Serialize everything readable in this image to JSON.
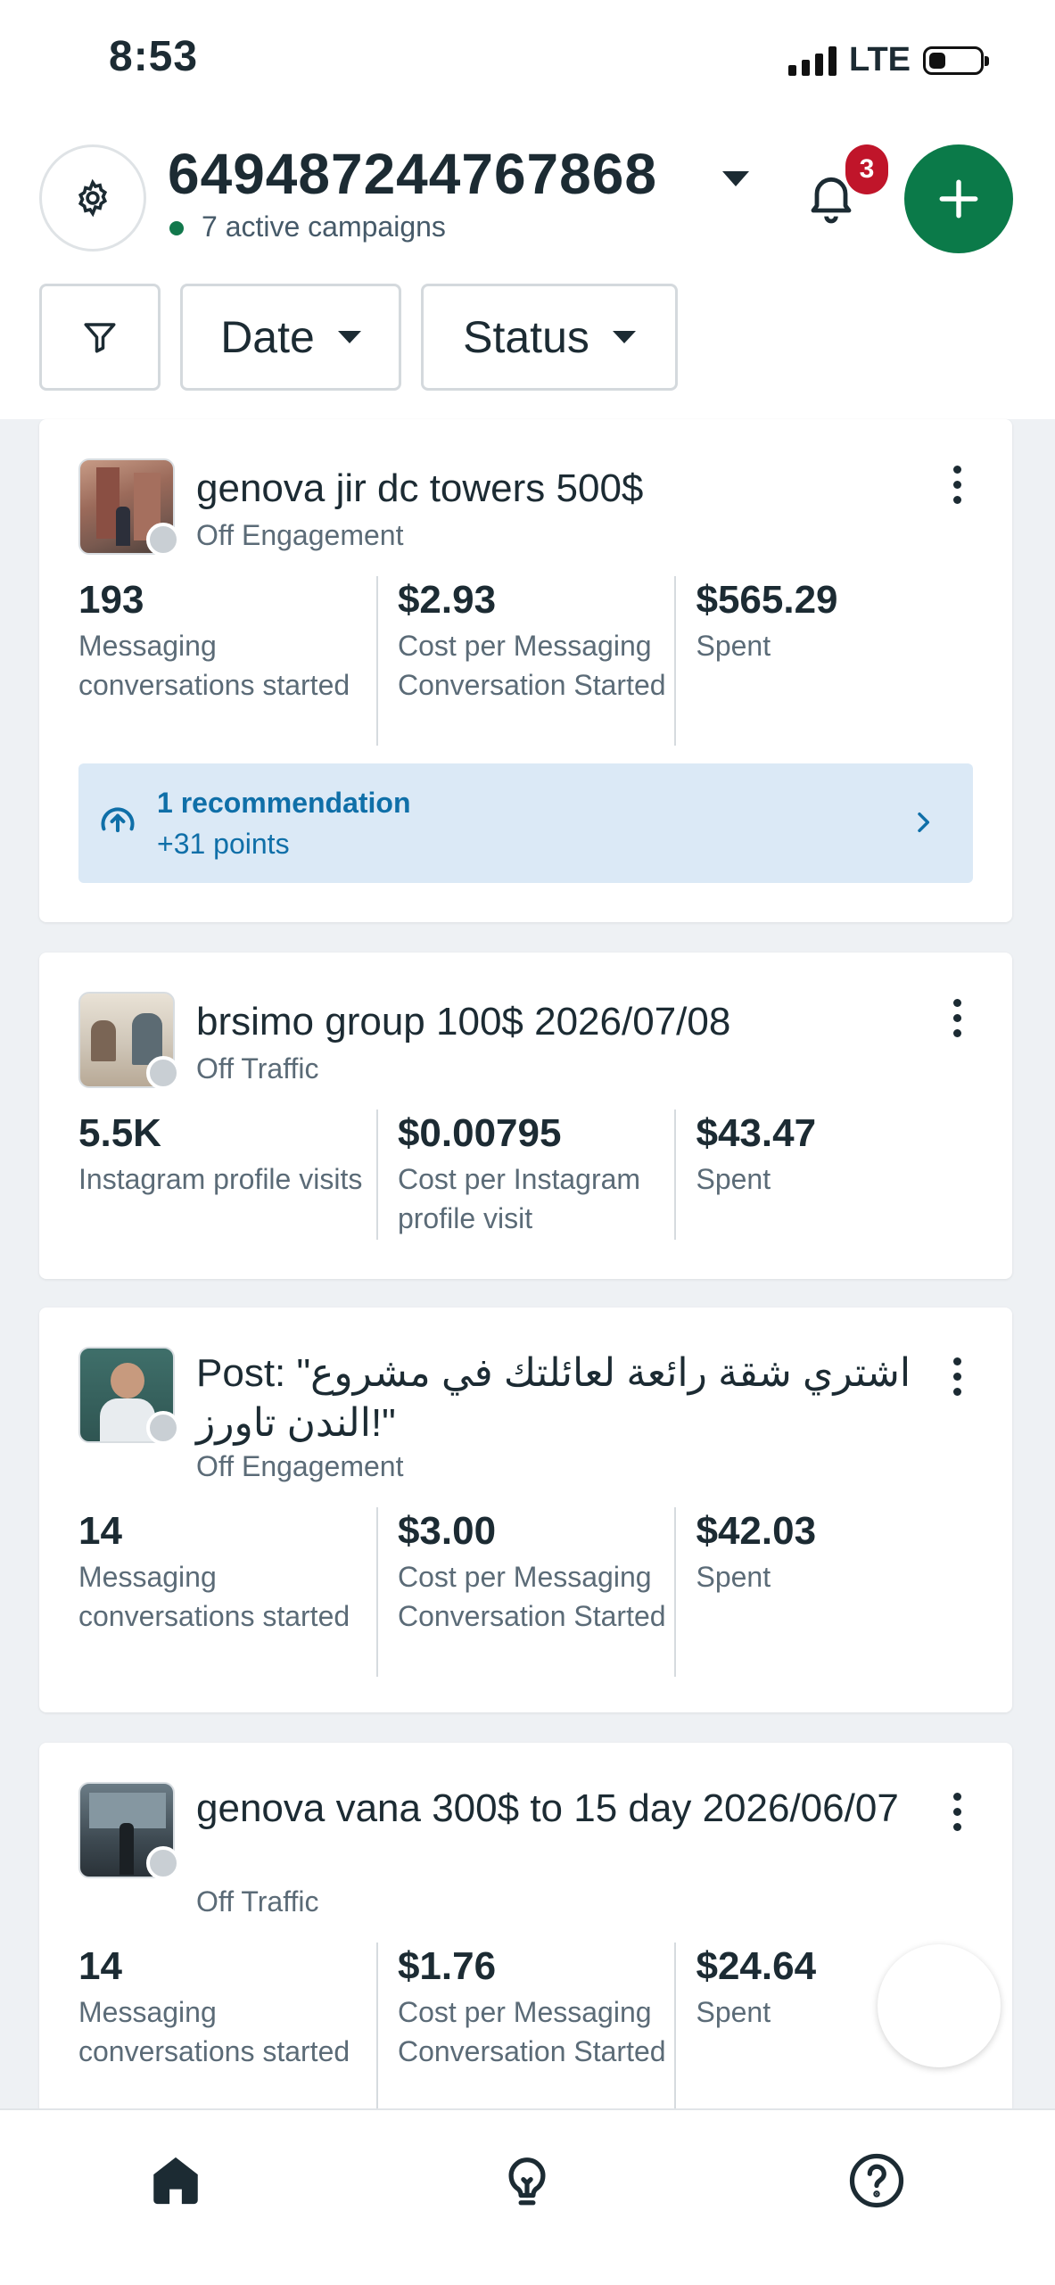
{
  "status_bar": {
    "time": "8:53",
    "network": "LTE"
  },
  "header": {
    "account_id": "649487244767868",
    "active_campaigns": "7 active campaigns",
    "notification_count": "3",
    "accent_color": "#0b7a49"
  },
  "filters": {
    "date_label": "Date",
    "status_label": "Status"
  },
  "campaigns": [
    {
      "title": "genova jir dc towers  500$",
      "status": "Off",
      "objective": "Engagement",
      "metrics": [
        {
          "value": "193",
          "label": "Messaging conversations started"
        },
        {
          "value": "$2.93",
          "label": "Cost per Messaging Conversation Started"
        },
        {
          "value": "$565.29",
          "label": "Spent"
        }
      ],
      "recommendation": {
        "title": "1 recommendation",
        "points": "+31 points"
      }
    },
    {
      "title": "brsimo group 100$ 2026/07/08",
      "status": "Off",
      "objective": "Traffic",
      "metrics": [
        {
          "value": "5.5K",
          "label": "Instagram profile visits"
        },
        {
          "value": "$0.00795",
          "label": "Cost per Instagram profile visit"
        },
        {
          "value": "$43.47",
          "label": "Spent"
        }
      ]
    },
    {
      "title": "Post: \"اشتري شقة رائعة لعائلتك في مشروع الندن تاورز!\"",
      "status": "Off",
      "objective": "Engagement",
      "metrics": [
        {
          "value": "14",
          "label": "Messaging conversations started"
        },
        {
          "value": "$3.00",
          "label": "Cost per Messaging Conversation Started"
        },
        {
          "value": "$42.03",
          "label": "Spent"
        }
      ]
    },
    {
      "title": "genova vana 300$ to  15 day 2026/06/07",
      "status": "Off",
      "objective": "Traffic",
      "metrics": [
        {
          "value": "14",
          "label": "Messaging conversations started"
        },
        {
          "value": "$1.76",
          "label": "Cost per Messaging Conversation Started"
        },
        {
          "value": "$24.64",
          "label": "Spent"
        }
      ]
    }
  ],
  "bottom_nav": [
    "home-icon",
    "lightbulb-icon",
    "help-icon"
  ]
}
